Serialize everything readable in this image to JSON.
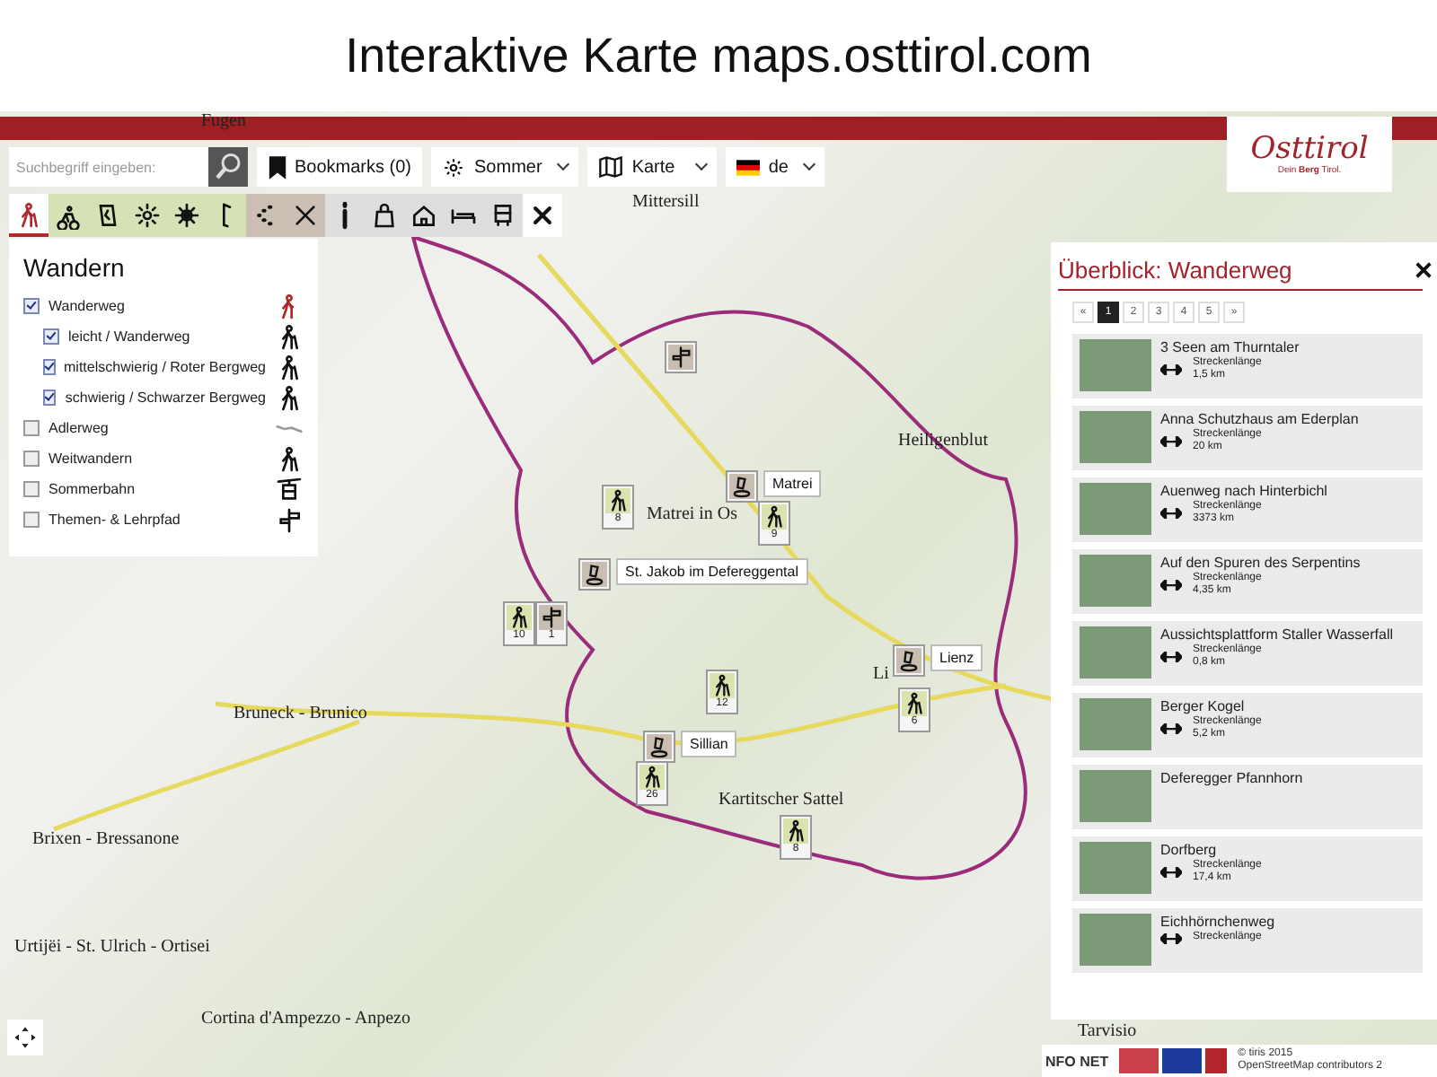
{
  "page_title": "Interaktive Karte maps.osttirol.com",
  "logo": {
    "wordmark": "Osttirol",
    "tagline": "Dein **Berg** Tirol."
  },
  "search": {
    "placeholder": "Suchbegriff eingeben:"
  },
  "bookmarks": {
    "label": "Bookmarks (0)"
  },
  "season": {
    "label": "Sommer"
  },
  "map_type": {
    "label": "Karte"
  },
  "language": {
    "label": "de"
  },
  "category_bar": [
    {
      "kind": "hiker",
      "color": "#ffffff",
      "selected": true
    },
    {
      "kind": "bike",
      "color": "#d6e2b6",
      "selected": false
    },
    {
      "kind": "climb",
      "color": "#d6e2b6",
      "selected": false
    },
    {
      "kind": "sun",
      "color": "#d6e2b6",
      "selected": false
    },
    {
      "kind": "burst",
      "color": "#d6e2b6",
      "selected": false
    },
    {
      "kind": "golf",
      "color": "#d6e2b6",
      "selected": false
    },
    {
      "kind": "dots",
      "color": "#cbbfb3",
      "selected": false
    },
    {
      "kind": "crossed",
      "color": "#cbbfb3",
      "selected": false
    },
    {
      "kind": "info",
      "color": "#dedede",
      "selected": false
    },
    {
      "kind": "bag",
      "color": "#dedede",
      "selected": false
    },
    {
      "kind": "hut",
      "color": "#dedede",
      "selected": false
    },
    {
      "kind": "bed",
      "color": "#dedede",
      "selected": false
    },
    {
      "kind": "bus",
      "color": "#dedede",
      "selected": false
    },
    {
      "kind": "close",
      "color": "#ffffff",
      "selected": false
    }
  ],
  "legend": {
    "title": "Wandern",
    "items": [
      {
        "label": "Wanderweg",
        "checked": true,
        "kind": "hiker-red",
        "children": [
          {
            "label": "leicht / Wanderweg",
            "checked": true,
            "kind": "hiker"
          },
          {
            "label": "mittelschwierig / Roter Bergweg",
            "checked": true,
            "kind": "hiker"
          },
          {
            "label": "schwierig / Schwarzer Bergweg",
            "checked": true,
            "kind": "hiker"
          }
        ]
      },
      {
        "label": "Adlerweg",
        "checked": false,
        "kind": "trail"
      },
      {
        "label": "Weitwandern",
        "checked": false,
        "kind": "hiker"
      },
      {
        "label": "Sommerbahn",
        "checked": false,
        "kind": "gondola"
      },
      {
        "label": "Themen- & Lehrpfad",
        "checked": false,
        "kind": "signpost"
      }
    ]
  },
  "map": {
    "place_names": [
      "Fugen",
      "Mittersill",
      "Heiligenblut",
      "Matrei in Os",
      "Bruneck - Brunico",
      "Brixen - Bressanone",
      "Urtijëi - St. Ulrich - Ortisei",
      "Cortina d'Ampezzo - Anpezo",
      "Kartitscher Sattel",
      "Li",
      "Tarvisio"
    ],
    "markers": [
      {
        "kind": "signpost"
      },
      {
        "kind": "hiker",
        "count": "8"
      },
      {
        "kind": "photo",
        "tag": "Matrei"
      },
      {
        "kind": "hiker",
        "count": "9"
      },
      {
        "kind": "photo",
        "tag": "St. Jakob im Defereggental"
      },
      {
        "kind": "hiker",
        "count": "10"
      },
      {
        "kind": "signpost",
        "count": "1"
      },
      {
        "kind": "hiker",
        "count": "12"
      },
      {
        "kind": "photo",
        "tag": "Lienz"
      },
      {
        "kind": "hiker",
        "count": "6"
      },
      {
        "kind": "photo",
        "tag": "Sillian"
      },
      {
        "kind": "hiker",
        "count": "26"
      },
      {
        "kind": "hiker",
        "count": "8"
      }
    ]
  },
  "overview": {
    "title": "Überblick: Wanderweg",
    "pagination": [
      {
        "label": "«",
        "selected": false
      },
      {
        "label": "1",
        "selected": true
      },
      {
        "label": "2",
        "selected": false
      },
      {
        "label": "3",
        "selected": false
      },
      {
        "label": "4",
        "selected": false
      },
      {
        "label": "5",
        "selected": false
      },
      {
        "label": "»",
        "selected": false
      }
    ],
    "items": [
      {
        "title": "3 Seen am Thurntaler",
        "length_label": "Streckenlänge",
        "length": "1,5 km"
      },
      {
        "title": "Anna Schutzhaus am Ederplan",
        "length_label": "Streckenlänge",
        "length": "20 km"
      },
      {
        "title": "Auenweg nach Hinterbichl",
        "length_label": "Streckenlänge",
        "length": "3373 km"
      },
      {
        "title": "Auf den Spuren des Serpentins",
        "length_label": "Streckenlänge",
        "length": "4,35 km"
      },
      {
        "title": "Aussichtsplattform Staller Wasserfall",
        "length_label": "Streckenlänge",
        "length": "0,8 km"
      },
      {
        "title": "Berger Kogel",
        "length_label": "Streckenlänge",
        "length": "5,2 km"
      },
      {
        "title": "Deferegger Pfannhorn"
      },
      {
        "title": "Dorfberg",
        "length_label": "Streckenlänge",
        "length": "17,4 km"
      },
      {
        "title": "Eichhörnchenweg",
        "length_label": "Streckenlänge"
      }
    ]
  },
  "footer": {
    "brand": "NFO NET",
    "copyright": "© tiris 2015",
    "osm": "OpenStreetMap contributors 2"
  }
}
